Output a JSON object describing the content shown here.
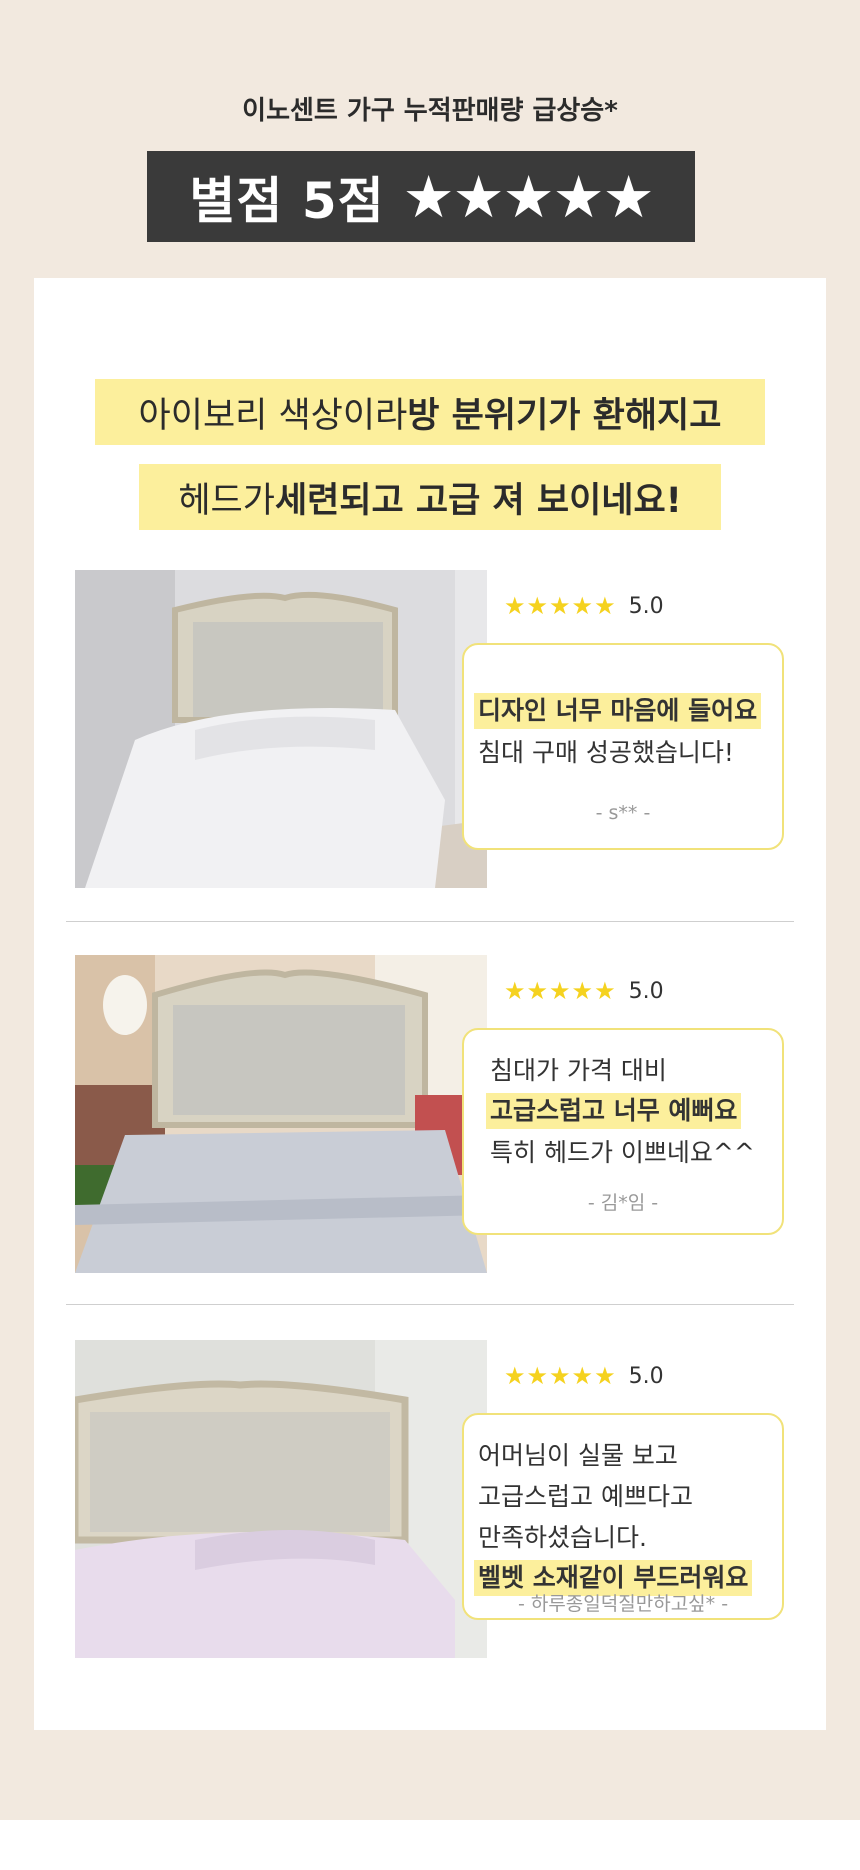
{
  "header": {
    "headline": "이노센트 가구 누적판매량 급상승*",
    "rating_text": "별점 5점",
    "rating_stars": "★★★★★"
  },
  "highlight": {
    "line1_normal": "아이보리 색상이라 ",
    "line1_bold": "방 분위기가 환해지고",
    "line2_normal": "헤드가 ",
    "line2_bold": "세련되고 고급 져 보이네요!"
  },
  "reviews": [
    {
      "stars": "★★★★★",
      "score": "5.0",
      "lines": [
        "디자인 너무 마음에 들어요",
        "침대 구매 성공했습니다!"
      ],
      "author": "- s** -"
    },
    {
      "stars": "★★★★★",
      "score": "5.0",
      "lines": [
        "침대가 가격 대비",
        "고급스럽고 너무 예뻐요",
        "특히 헤드가 이쁘네요^^"
      ],
      "author": "- 김*임 -"
    },
    {
      "stars": "★★★★★",
      "score": "5.0",
      "lines": [
        "어머님이 실물 보고",
        "고급스럽고 예쁘다고",
        "만족하셨습니다.",
        "벨벳 소재같이 부드러워요"
      ],
      "author": "- 하루종일덕질만하고싶* -"
    }
  ],
  "colors": {
    "page_bg": "#f2e9df",
    "banner_bg": "#3a3a3a",
    "highlight": "#fcef9c",
    "star": "#f5d21f",
    "bubble_border": "#f1e27a"
  }
}
